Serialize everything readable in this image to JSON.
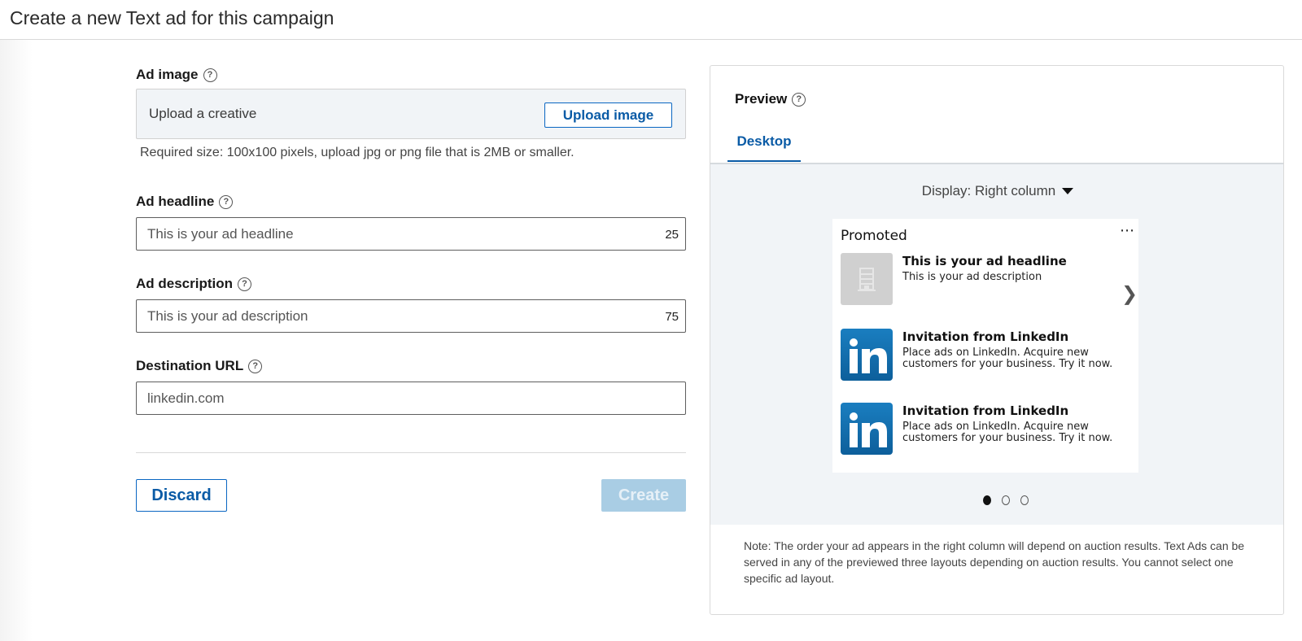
{
  "header": {
    "title": "Create a new Text ad for this campaign"
  },
  "form": {
    "ad_image": {
      "label": "Ad image",
      "upload_prompt": "Upload a creative",
      "upload_button": "Upload image",
      "hint": "Required size: 100x100 pixels, upload jpg or png file that is 2MB or smaller."
    },
    "ad_headline": {
      "label": "Ad headline",
      "placeholder": "This is your ad headline",
      "remaining_chars": "25"
    },
    "ad_description": {
      "label": "Ad description",
      "placeholder": "This is your ad description",
      "remaining_chars": "75"
    },
    "destination_url": {
      "label": "Destination URL",
      "value": "linkedin.com"
    },
    "buttons": {
      "discard": "Discard",
      "create": "Create"
    }
  },
  "preview": {
    "title": "Preview",
    "tabs": [
      {
        "label": "Desktop",
        "active": true
      }
    ],
    "display_select": "Display: Right column",
    "card": {
      "label": "Promoted",
      "more": "⋯",
      "next": "❯",
      "ads": [
        {
          "headline": "This is your ad headline",
          "description": "This is your ad description",
          "thumb": "placeholder-building"
        },
        {
          "headline": "Invitation from LinkedIn",
          "description": "Place ads on LinkedIn. Acquire new customers for your business. Try it now.",
          "thumb": "linkedin-logo"
        },
        {
          "headline": "Invitation from LinkedIn",
          "description": "Place ads on LinkedIn. Acquire new customers for your business. Try it now.",
          "thumb": "linkedin-logo"
        }
      ],
      "layout_pages": 3,
      "active_page": 1
    },
    "note": "Note: The order your ad appears in the right column will depend on auction results. Text Ads can be served in any of the previewed three layouts depending on auction results. You cannot select one specific ad layout."
  },
  "colors": {
    "accent": "#0a66c2",
    "create_disabled": "#a9cde4",
    "stage_bg": "#f1f4f7"
  }
}
